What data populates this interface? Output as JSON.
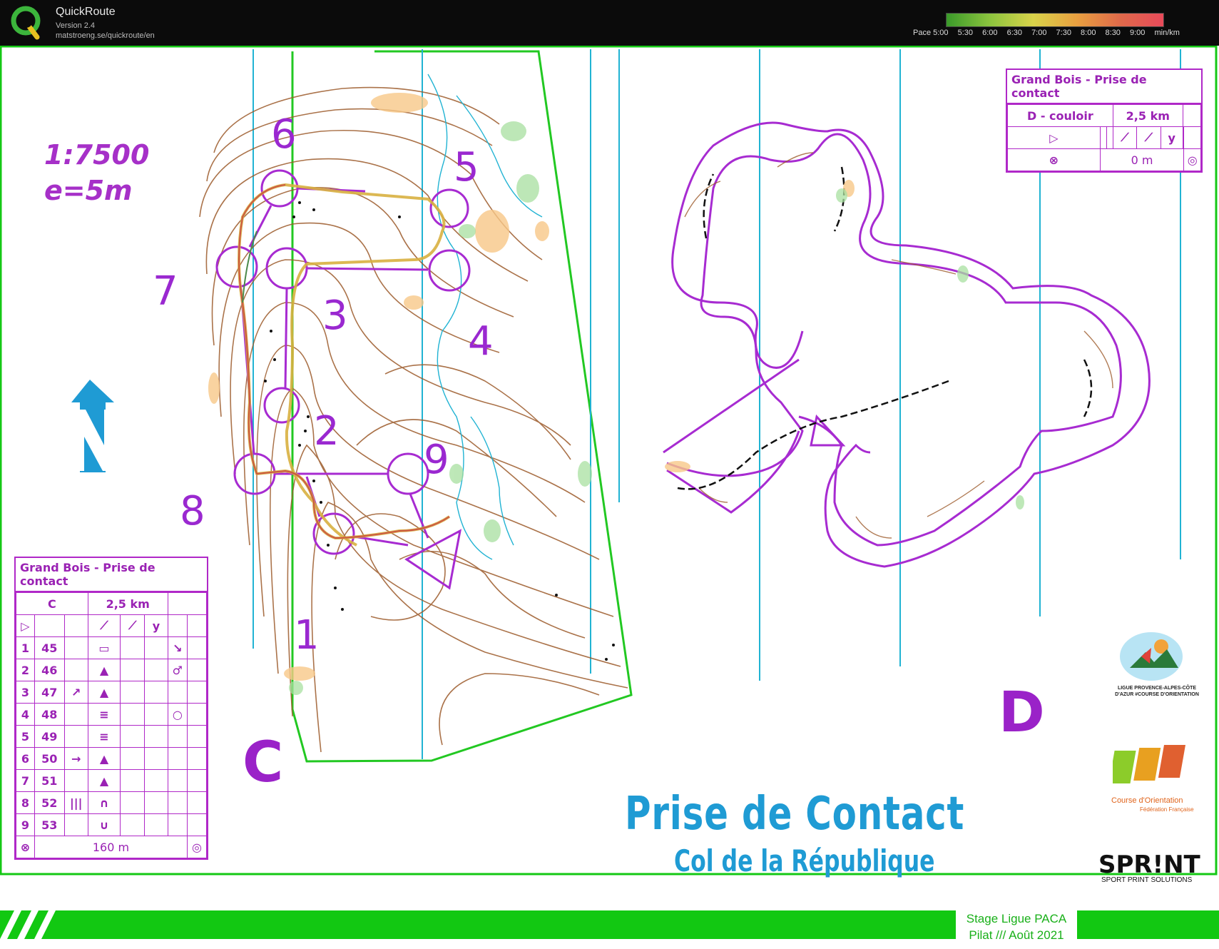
{
  "app": {
    "name": "QuickRoute",
    "version": "Version 2.4",
    "url": "matstroeng.se/quickroute/en"
  },
  "pace_scale": {
    "labels": [
      "Pace 5:00",
      "5:30",
      "6:00",
      "6:30",
      "7:00",
      "7:30",
      "8:00",
      "8:30",
      "9:00",
      "min/km"
    ]
  },
  "map": {
    "scale_line1": "1:7500",
    "scale_line2": "e=5m",
    "course_c_letter": "C",
    "course_d_letter": "D",
    "title_main": "Prise de Contact",
    "title_sub": "Col de la République",
    "control_numbers": [
      "1",
      "2",
      "3",
      "4",
      "5",
      "6",
      "7",
      "8",
      "9"
    ],
    "colors": {
      "course": "#a72bd1",
      "contour": "#9c5a2a",
      "water": "#21b3d3",
      "title": "#1f9bd4",
      "footer": "#12c812"
    }
  },
  "description_c": {
    "title": "Grand Bois - Prise de contact",
    "class": "C",
    "length": "2,5 km",
    "rows": [
      {
        "num": "1",
        "code": "45",
        "dir": "",
        "feature": "▭",
        "extra": "↘"
      },
      {
        "num": "2",
        "code": "46",
        "dir": "",
        "feature": "▲",
        "extra": "♂"
      },
      {
        "num": "3",
        "code": "47",
        "dir": "↗",
        "feature": "▲",
        "extra": ""
      },
      {
        "num": "4",
        "code": "48",
        "dir": "",
        "feature": "≡",
        "extra": "○"
      },
      {
        "num": "5",
        "code": "49",
        "dir": "",
        "feature": "≡",
        "extra": ""
      },
      {
        "num": "6",
        "code": "50",
        "dir": "→",
        "feature": "▲",
        "extra": ""
      },
      {
        "num": "7",
        "code": "51",
        "dir": "",
        "feature": "▲",
        "extra": ""
      },
      {
        "num": "8",
        "code": "52",
        "dir": "|||",
        "feature": "∩",
        "extra": ""
      },
      {
        "num": "9",
        "code": "53",
        "dir": "",
        "feature": "∪",
        "extra": ""
      }
    ],
    "finish": "160 m"
  },
  "description_d": {
    "title": "Grand Bois - Prise de contact",
    "class": "D - couloir",
    "length": "2,5 km",
    "finish": "0 m"
  },
  "logos": {
    "ligue": "LIGUE PROVENCE-ALPES-CÔTE D'AZUR #COURSE D'ORIENTATION",
    "ffco_line1": "Course d'Orientation",
    "ffco_line2": "Fédération Française",
    "sprint": "SPR!NT",
    "sprint_sub": "SPORT PRINT SOLUTIONS"
  },
  "footer": {
    "line1": "Stage Ligue PACA",
    "line2": "Pilat /// Août 2021"
  }
}
